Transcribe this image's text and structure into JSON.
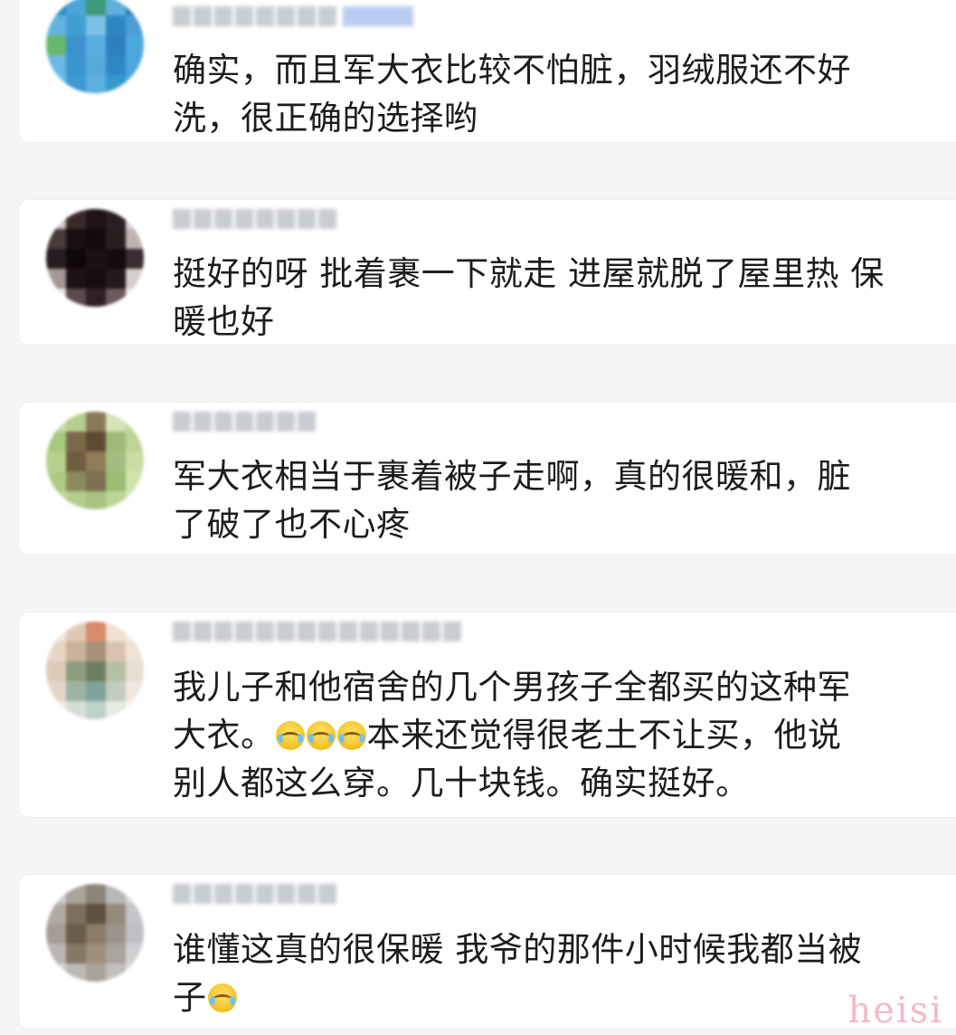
{
  "comments": [
    {
      "text_line1": "确实，而且军大衣比较不怕脏，羽绒服还不好",
      "text_line2": "洗，很正确的选择哟",
      "avatar_colors": [
        "#2a8fc9",
        "#4aa5d8",
        "#3d9a7a",
        "#5fb0dc",
        "#2f7fb8",
        "#62b3e0",
        "#3f9fd0",
        "#7cc0e5",
        "#2b86c2",
        "#4e9ed4",
        "#67b86f",
        "#3b92cc",
        "#58aee0",
        "#2d7fbf",
        "#4ba8dd",
        "#6ab9e4",
        "#3a95d0",
        "#55abd9",
        "#2f88c6",
        "#4da6dc",
        "#70bfe8",
        "#3e98d3",
        "#5bb0de",
        "#349acd",
        "#4fa9db"
      ]
    },
    {
      "text_line1": "挺好的呀 批着裹一下就走 进屋就脱了屋里热 保",
      "text_line2": "暖也好",
      "avatar_colors": [
        "#cfc6c2",
        "#3a2a2c",
        "#1e1316",
        "#2b1f22",
        "#d9d2cf",
        "#4a3a3c",
        "#1a1013",
        "#120a0d",
        "#2a1e21",
        "#bfb4b1",
        "#281c1f",
        "#0f080a",
        "#1a1114",
        "#140c0f",
        "#3b2d30",
        "#a59894",
        "#1d1316",
        "#160d10",
        "#24191c",
        "#d6cecb",
        "#e8e3e1",
        "#5a4a4c",
        "#2e2124",
        "#6b5b5d",
        "#f0ecea"
      ]
    },
    {
      "text_line1": "军大衣相当于裹着被子走啊，真的很暖和，脏",
      "text_line2": "了破了也不心疼",
      "avatar_colors": [
        "#c9dca8",
        "#b4cf8e",
        "#8a7a5a",
        "#d5e5b8",
        "#c2d99c",
        "#a8c97f",
        "#7a6a4a",
        "#5d4a33",
        "#9eb97a",
        "#bdd596",
        "#b7d08e",
        "#6e5d40",
        "#8f7d57",
        "#a2bd80",
        "#c8de9f",
        "#aecb86",
        "#8c8a5c",
        "#7d7050",
        "#9bbd74",
        "#d0e2ae",
        "#c4daa0",
        "#b2cd8c",
        "#a7c383",
        "#bcd597",
        "#d8e8bd"
      ]
    },
    {
      "text_line1": "我儿子和他宿舍的几个男孩子全都买的这种军",
      "text_line2_a": "大衣。",
      "text_line2_b": "本来还觉得很老土不让买，他说",
      "text_line3": "别人都这么穿。几十块钱。确实挺好。",
      "avatar_colors": [
        "#f1e7dc",
        "#e0c9b4",
        "#d98a6c",
        "#efe2d3",
        "#f5ede4",
        "#e6d6c6",
        "#c7b49a",
        "#a8927a",
        "#d8c4ae",
        "#eee3d6",
        "#dccbb8",
        "#8f9d7e",
        "#6d7f62",
        "#b6c0a4",
        "#e9dfd2",
        "#e3d6c7",
        "#9fb3a4",
        "#7fa39a",
        "#c3cdbd",
        "#f0e8de",
        "#f3ece4",
        "#d5dfd6",
        "#bfd1c9",
        "#e4ebe4",
        "#f6f1eb"
      ],
      "emoji_count": 3,
      "emoji_name": "laugh-cry-emoji"
    },
    {
      "text_line1": "谁懂这真的很保暖 我爷的那件小时候我都当被",
      "text_line2": "子",
      "avatar_colors": [
        "#c8cbd0",
        "#a9a49c",
        "#8d8478",
        "#b7b8bb",
        "#d2d4d8",
        "#b0aba3",
        "#7c6f5f",
        "#5e513f",
        "#958b7d",
        "#c4c5c8",
        "#a59e94",
        "#6b5d4b",
        "#8a7b66",
        "#9c948a",
        "#bfc0c3",
        "#b9b6b1",
        "#857865",
        "#9d8f7a",
        "#aaa49b",
        "#cfd0d3",
        "#d4d5d8",
        "#bcbab6",
        "#a8a39b",
        "#c1c0bd",
        "#dadbdd"
      ],
      "emoji_name": "crying-emoji"
    }
  ],
  "watermark": "heisi"
}
